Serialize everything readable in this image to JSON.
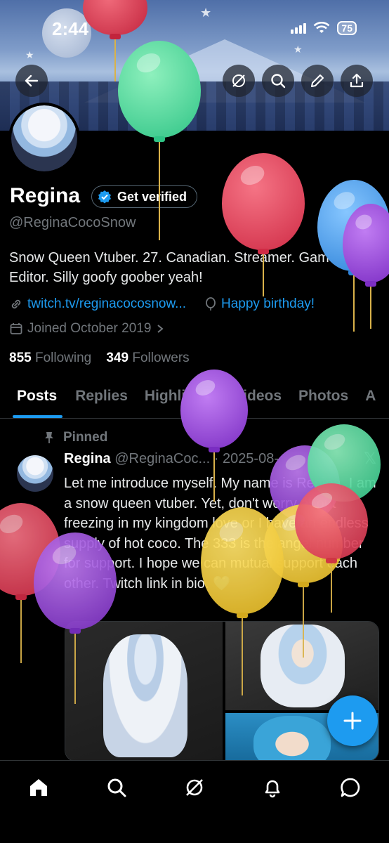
{
  "status_bar": {
    "time": "2:44",
    "battery": "75"
  },
  "profile": {
    "name": "Regina",
    "verify_label": "Get verified",
    "handle": "@ReginaCocoSnow",
    "bio_line1": "Snow Queen Vtuber. 27. Canadian. Streamer. Gamer.",
    "bio_line2": "Editor. Silly goofy goober yeah!",
    "link": "twitch.tv/reginacocosnow...",
    "birthday": "Happy birthday!",
    "joined": "Joined October 2019",
    "following_count": "855",
    "following_label": "Following",
    "followers_count": "349",
    "followers_label": "Followers"
  },
  "tabs": [
    "Posts",
    "Replies",
    "Highlights",
    "Videos",
    "Photos",
    "A"
  ],
  "post": {
    "pinned_label": "Pinned",
    "author": "Regina",
    "handle_date": "@ReginaCoc... · 2025-08-",
    "text": "Let me introduce myself. My name is Regina. I am a snow queen vtuber. Yet, don't worry about freezing in my kingdom love or I have an endless supply of hot coco. The 333 is the angel number for support. I hope we can mutual support each other. Twitch link in bio. 💙",
    "x_mark": "𝕏"
  },
  "colors": {
    "accent": "#1d9bf0",
    "background": "#000000",
    "muted": "#71767b"
  },
  "icons": [
    "back-arrow-icon",
    "grok-icon",
    "search-icon",
    "edit-icon",
    "share-icon",
    "verified-badge-icon",
    "link-icon",
    "balloon-icon",
    "calendar-icon",
    "chevron-right-icon",
    "pin-icon",
    "plus-icon",
    "home-icon",
    "notifications-icon",
    "messages-icon"
  ]
}
